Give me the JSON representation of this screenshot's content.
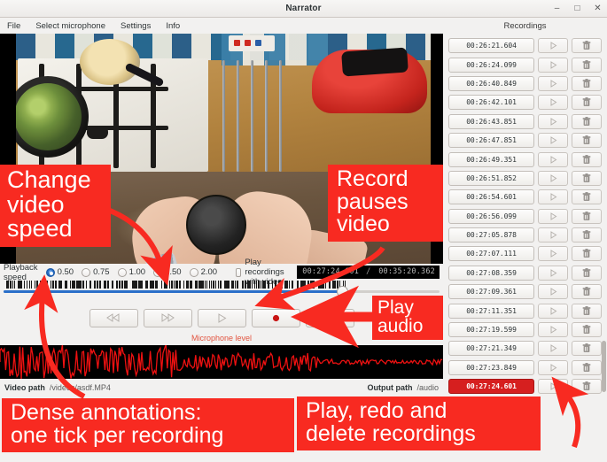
{
  "window": {
    "title": "Narrator",
    "minimize_label": "–",
    "maximize_label": "□",
    "close_label": "✕"
  },
  "menubar": {
    "items": [
      {
        "label": "File",
        "name": "menu-file"
      },
      {
        "label": "Select microphone",
        "name": "menu-select-microphone"
      },
      {
        "label": "Settings",
        "name": "menu-settings"
      },
      {
        "label": "Info",
        "name": "menu-info"
      }
    ]
  },
  "recordings_panel": {
    "header": "Recordings",
    "play_icon": "play-triangle-icon",
    "delete_icon": "trash-icon",
    "items": [
      {
        "time": "00:26:21.604",
        "selected": false
      },
      {
        "time": "00:26:24.099",
        "selected": false
      },
      {
        "time": "00:26:40.849",
        "selected": false
      },
      {
        "time": "00:26:42.101",
        "selected": false
      },
      {
        "time": "00:26:43.851",
        "selected": false
      },
      {
        "time": "00:26:47.851",
        "selected": false
      },
      {
        "time": "00:26:49.351",
        "selected": false
      },
      {
        "time": "00:26:51.852",
        "selected": false
      },
      {
        "time": "00:26:54.601",
        "selected": false
      },
      {
        "time": "00:26:56.099",
        "selected": false
      },
      {
        "time": "00:27:05.878",
        "selected": false
      },
      {
        "time": "00:27:07.111",
        "selected": false
      },
      {
        "time": "00:27:08.359",
        "selected": false
      },
      {
        "time": "00:27:09.361",
        "selected": false
      },
      {
        "time": "00:27:11.351",
        "selected": false
      },
      {
        "time": "00:27:19.599",
        "selected": false
      },
      {
        "time": "00:27:21.349",
        "selected": false
      },
      {
        "time": "00:27:23.849",
        "selected": false
      },
      {
        "time": "00:27:24.601",
        "selected": true
      }
    ]
  },
  "playback": {
    "speed_label": "Playback speed",
    "speeds": [
      {
        "value": "0.50",
        "selected": true
      },
      {
        "value": "0.75",
        "selected": false
      },
      {
        "value": "1.00",
        "selected": false
      },
      {
        "value": "1.50",
        "selected": false
      },
      {
        "value": "2.00",
        "selected": false
      }
    ],
    "play_with_video_label": "Play recordings with video",
    "play_with_video_checked": false,
    "current_time": "00:27:24.601",
    "time_separator": "/",
    "total_time": "00:35:20.362",
    "progress_percent": 77.6
  },
  "transport": {
    "buttons": [
      {
        "name": "rewind-button",
        "icon": "rewind-icon"
      },
      {
        "name": "fast-forward-button",
        "icon": "fast-forward-icon"
      },
      {
        "name": "play-button",
        "icon": "play-triangle-icon"
      },
      {
        "name": "record-button",
        "icon": "record-dot-icon"
      },
      {
        "name": "play-audio-button",
        "icon": "speaker-icon"
      }
    ]
  },
  "microphone": {
    "level_label": "Microphone level"
  },
  "status_bar": {
    "video_path_label": "Video path",
    "video_path_value": "/videos/asdf.MP4",
    "output_path_label": "Output path",
    "output_path_value": "/audio"
  },
  "annotations": [
    {
      "id": "ann-speed",
      "name": "annotation-change-video-speed",
      "lines": [
        "Change",
        "video",
        "speed"
      ]
    },
    {
      "id": "ann-record",
      "name": "annotation-record-pauses-video",
      "lines": [
        "Record",
        "pauses",
        "video"
      ]
    },
    {
      "id": "ann-playaudio",
      "name": "annotation-play-audio",
      "lines": [
        "Play",
        "audio"
      ]
    },
    {
      "id": "ann-dense",
      "name": "annotation-dense-annotations",
      "lines": [
        "Dense annotations:",
        "one tick per recording"
      ]
    },
    {
      "id": "ann-delete",
      "name": "annotation-play-redo-delete",
      "lines": [
        "Play, redo and",
        "delete recordings"
      ]
    }
  ],
  "colors": {
    "annotation_red": "#f82a21",
    "selected_row_red": "#d61f1f",
    "progress_blue": "#2a6fc9",
    "waveform_red": "#ee1111",
    "panel_gray": "#f2f1f0"
  }
}
